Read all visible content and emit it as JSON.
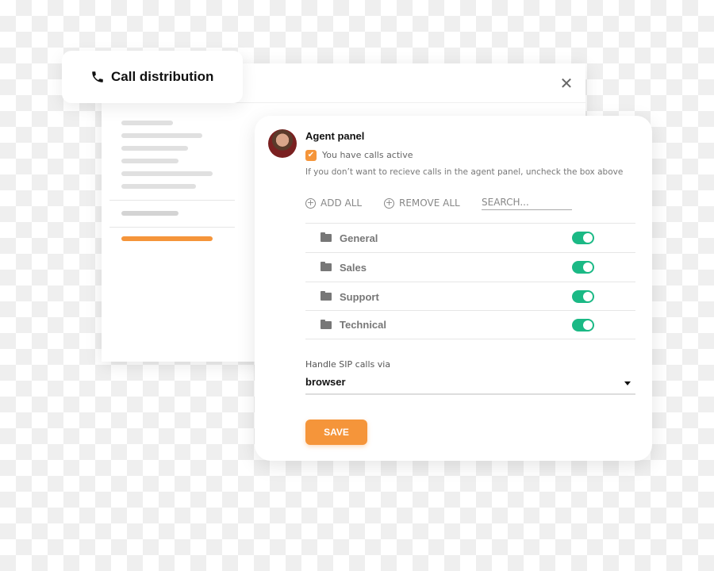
{
  "window": {
    "title": "Call distribution",
    "title_icon": "phone-icon",
    "close_icon": "close-icon"
  },
  "panel": {
    "title": "Agent panel",
    "calls_active": {
      "label": "You have calls active",
      "checked": true
    },
    "help_text": "If you don’t want to recieve calls in the agent panel, uncheck the box above",
    "actions": {
      "add_all": "ADD ALL",
      "remove_all": "REMOVE ALL",
      "search_placeholder": "SEARCH..."
    },
    "queues": [
      {
        "name": "General",
        "enabled": true
      },
      {
        "name": "Sales",
        "enabled": true
      },
      {
        "name": "Support",
        "enabled": true
      },
      {
        "name": "Technical",
        "enabled": true
      }
    ],
    "sip": {
      "label": "Handle SIP calls via",
      "value": "browser"
    },
    "save_label": "SAVE"
  },
  "colors": {
    "accent": "#f5953a",
    "toggle_on": "#1bb985"
  }
}
